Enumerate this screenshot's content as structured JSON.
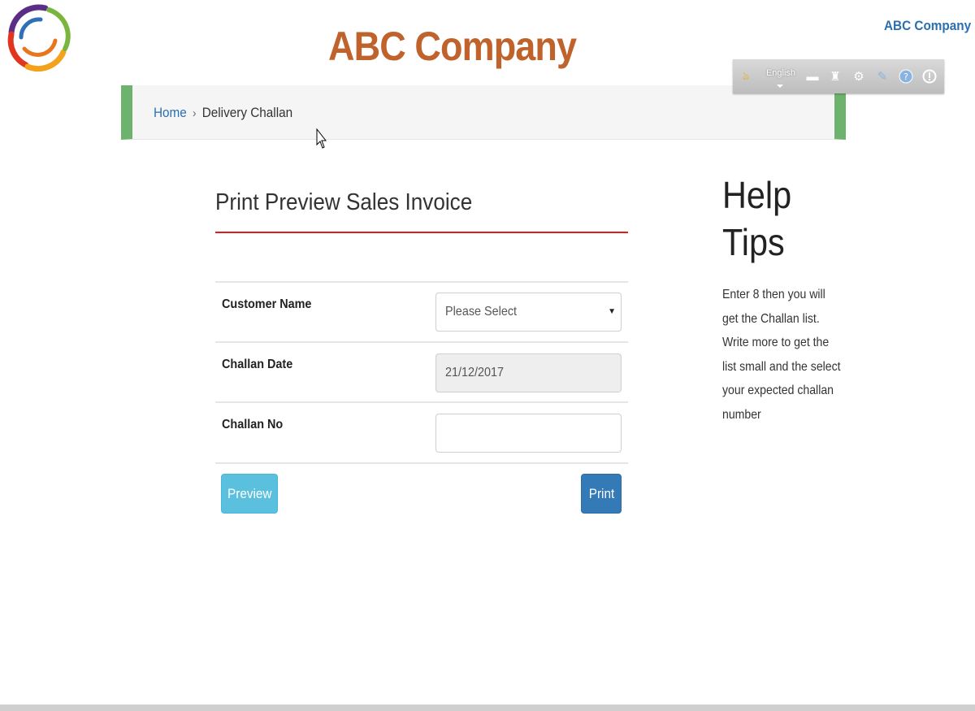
{
  "header": {
    "company_title": "ABC Company",
    "user_menu": "ABC Company"
  },
  "toolbar": {
    "language": "English",
    "icons": [
      "brand-icon",
      "keyboard-icon",
      "tool-icon",
      "gear-icon",
      "edit-icon",
      "help-icon",
      "info-icon"
    ]
  },
  "breadcrumb": {
    "home": "Home",
    "separator": "›",
    "current": "Delivery Challan"
  },
  "form": {
    "title": "Print Preview Sales Invoice",
    "fields": {
      "customer_name": {
        "label": "Customer Name",
        "value": "Please Select"
      },
      "challan_date": {
        "label": "Challan Date",
        "value": "21/12/2017"
      },
      "challan_no": {
        "label": "Challan No",
        "value": ""
      }
    },
    "buttons": {
      "preview": "Preview",
      "print": "Print"
    }
  },
  "help": {
    "title_line1": "Help",
    "title_line2": "Tips",
    "text": "Enter 8 then you will get the Challan list. Write more to get the list small and the select your expected challan number"
  },
  "colors": {
    "title": "#c0622c",
    "link": "#2a6fb0",
    "accent_green": "#6db36d",
    "rule_red": "#e41a1a",
    "preview_button": "#5bc0de",
    "print_button": "#337ab7"
  }
}
